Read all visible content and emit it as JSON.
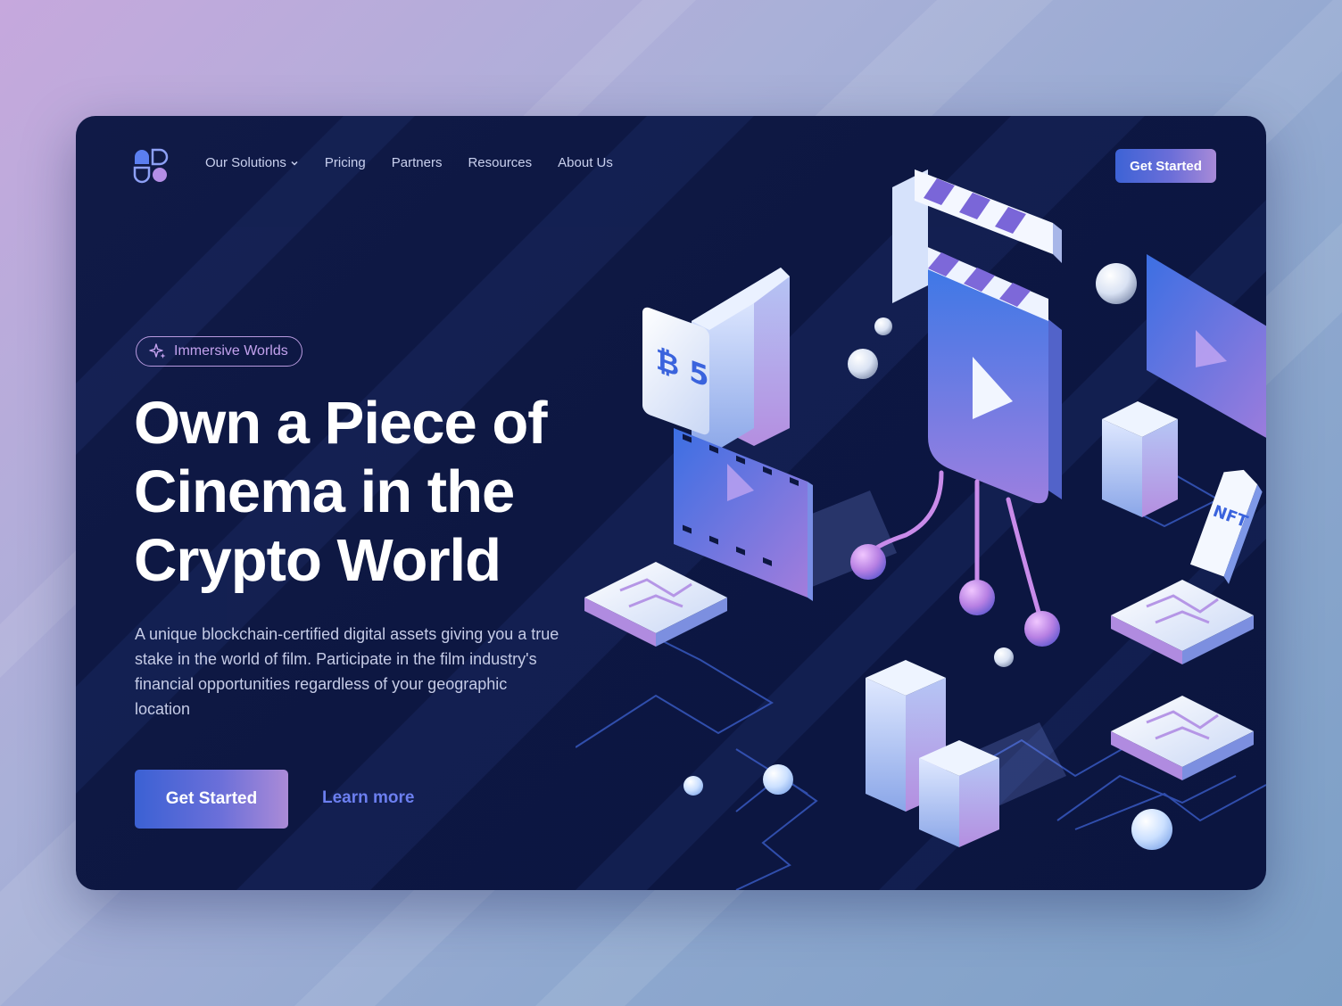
{
  "nav": {
    "items": [
      {
        "label": "Our Solutions",
        "has_dropdown": true
      },
      {
        "label": "Pricing"
      },
      {
        "label": "Partners"
      },
      {
        "label": "Resources"
      },
      {
        "label": "About Us"
      }
    ],
    "cta_label": "Get Started"
  },
  "hero": {
    "badge_label": "Immersive Worlds",
    "headline_lines": [
      "Own a Piece of",
      "Cinema in the",
      "Crypto World"
    ],
    "description": "A unique blockchain-certified digital assets giving you a true stake in the world of film. Participate in the film industry's financial opportunities regardless of your geographic location",
    "primary_button": "Get Started",
    "secondary_link": "Learn more"
  },
  "illustration": {
    "coin_text": "₿ 5",
    "tag_text": "NFT"
  },
  "colors": {
    "page_bg_start": "#c6a8dd",
    "page_bg_end": "#7c9fc6",
    "card_bg": "#0d1742",
    "accent_blue": "#3d63d6",
    "accent_purple": "#a88ad8",
    "link": "#6c7ff0",
    "badge": "#c3a2ee"
  }
}
